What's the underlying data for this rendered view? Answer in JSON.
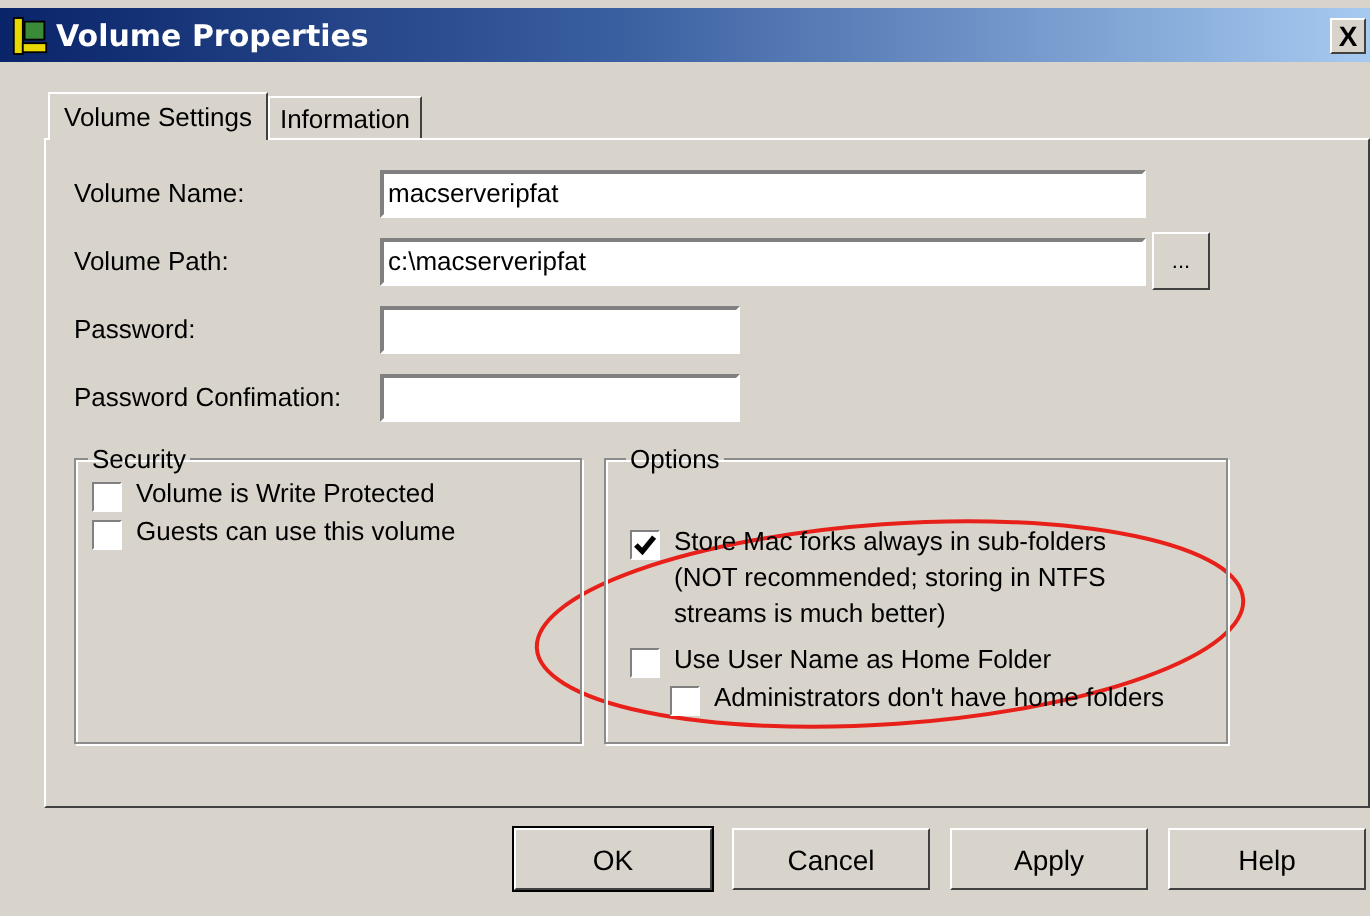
{
  "window": {
    "title": "Volume Properties",
    "close": "X"
  },
  "tabs": [
    {
      "label": "Volume Settings",
      "selected": true
    },
    {
      "label": "Information",
      "selected": false
    }
  ],
  "fields": [
    {
      "label": "Volume Name:",
      "value": "macserveripfat",
      "wide": true
    },
    {
      "label": "Volume Path:",
      "value": "c:\\macserveripfat",
      "wide": true,
      "browse": "..."
    },
    {
      "label": "Password:",
      "wide": false
    },
    {
      "label": "Password Confimation:",
      "wide": false
    }
  ],
  "security": {
    "title": "Security",
    "options": [
      {
        "label": "Volume is Write Protected",
        "checked": false
      },
      {
        "label": "Guests can use this volume",
        "checked": false
      }
    ]
  },
  "options": {
    "title": "Options",
    "options": [
      {
        "label": "Store Mac forks always in sub-folders (NOT recommended; storing in NTFS streams is much better)",
        "checked": true
      },
      {
        "label": "Use User Name as Home Folder",
        "checked": false,
        "children": [
          {
            "label": "Administrators don't have home folders",
            "checked": false
          }
        ]
      }
    ]
  },
  "buttons": [
    {
      "label": "OK",
      "default": true
    },
    {
      "label": "Cancel",
      "default": false
    },
    {
      "label": "Apply",
      "default": false
    },
    {
      "label": "Help",
      "default": false
    }
  ]
}
